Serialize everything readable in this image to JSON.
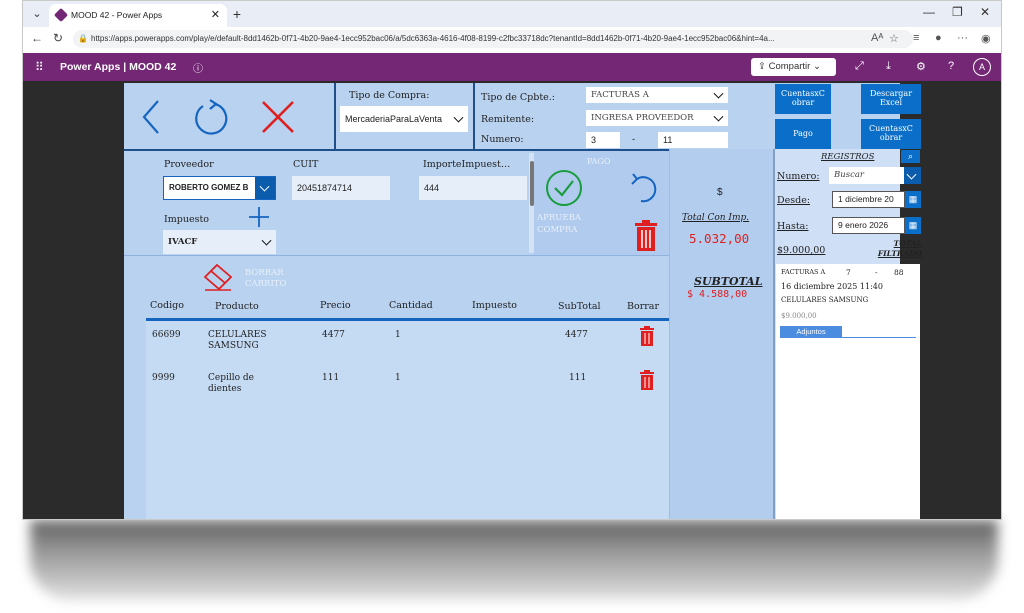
{
  "browser": {
    "tab_title": "MOOD 42 - Power Apps",
    "url": "https://apps.powerapps.com/play/e/default-8dd1462b-0f71-4b20-9ae4-1ecc952bac06/a/5dc6363a-4616-4f08-8199-c2fbc33718dc?tenantId=8dd1462b-0f71-4b20-9ae4-1ecc952bac06&hint=4a..."
  },
  "header": {
    "app_name": "Power Apps",
    "separator": "|",
    "app_title": "MOOD 42",
    "share_label": "Compartir",
    "avatar_initial": "A"
  },
  "compra": {
    "tipo_compra_label": "Tipo de Compra:",
    "tipo_compra_value": "MercaderiaParaLaVenta",
    "tipo_cpbte_label": "Tipo de Cpbte.:",
    "tipo_cpbte_value": "FACTURAS A",
    "remitente_label": "Remitente:",
    "remitente_value": "INGRESA PROVEEDOR",
    "numero_label": "Numero:",
    "numero_a": "3",
    "numero_sep": "-",
    "numero_b": "11"
  },
  "buttons": {
    "cuentas_obrar_1": "CuentasxC obrar",
    "descargar_excel": "Descargar Excel",
    "pago": "Pago",
    "cuentas_obrar_2": "CuentasxC obrar",
    "pago_label": "PAGO",
    "aprueba_compra": "APRUEBA COMPRA",
    "borrar_carrito": "BORRAR CARRITO"
  },
  "proveedor": {
    "proveedor_label": "Proveedor",
    "proveedor_value": "ROBERTO GOMEZ B",
    "cuit_label": "CUIT",
    "cuit_value": "20451874714",
    "importe_label": "ImporteImpuest…",
    "importe_value": "444",
    "impuesto_label": "Impuesto",
    "impuesto_value": "IVACF"
  },
  "totals": {
    "dollar": "$",
    "total_con_imp_label": "Total Con Imp.",
    "total_con_imp_value": "5.032,00",
    "subtotal_label": "SUBTOTAL",
    "subtotal_value": "$ 4.588,00"
  },
  "table": {
    "headers": [
      "Codigo",
      "Producto",
      "Precio",
      "Cantidad",
      "Impuesto",
      "SubTotal",
      "Borrar"
    ],
    "rows": [
      {
        "codigo": "66699",
        "producto": "CELULARES SAMSUNG",
        "precio": "4477",
        "cantidad": "1",
        "impuesto": "",
        "subtotal": "4477"
      },
      {
        "codigo": "9999",
        "producto": "Cepillo de dientes",
        "precio": "111",
        "cantidad": "1",
        "impuesto": "",
        "subtotal": "111"
      }
    ]
  },
  "registros": {
    "title": "REGISTROS",
    "numero_label": "Numero:",
    "numero_placeholder": "Buscar",
    "desde_label": "Desde:",
    "desde_value": "1 diciembre 20",
    "hasta_label": "Hasta:",
    "hasta_value": "9 enero 2026",
    "total_value": "$9.000,00",
    "total_filtrado_label": "TOTAL FILTRADO",
    "item": {
      "tipo": "FACTURAS A",
      "num_a": "7",
      "sep": "-",
      "num_b": "88",
      "fecha": "16 diciembre 2025 11:40",
      "producto": "CELULARES SAMSUNG",
      "monto": "$9.000,00",
      "adjuntos": "Adjuntos"
    }
  },
  "colors": {
    "brand": "#742774",
    "app_bg": "#b8d2f0",
    "accent_blue": "#0b6fc9",
    "total_red": "#e02020",
    "approve_green": "#1a9c3e"
  }
}
